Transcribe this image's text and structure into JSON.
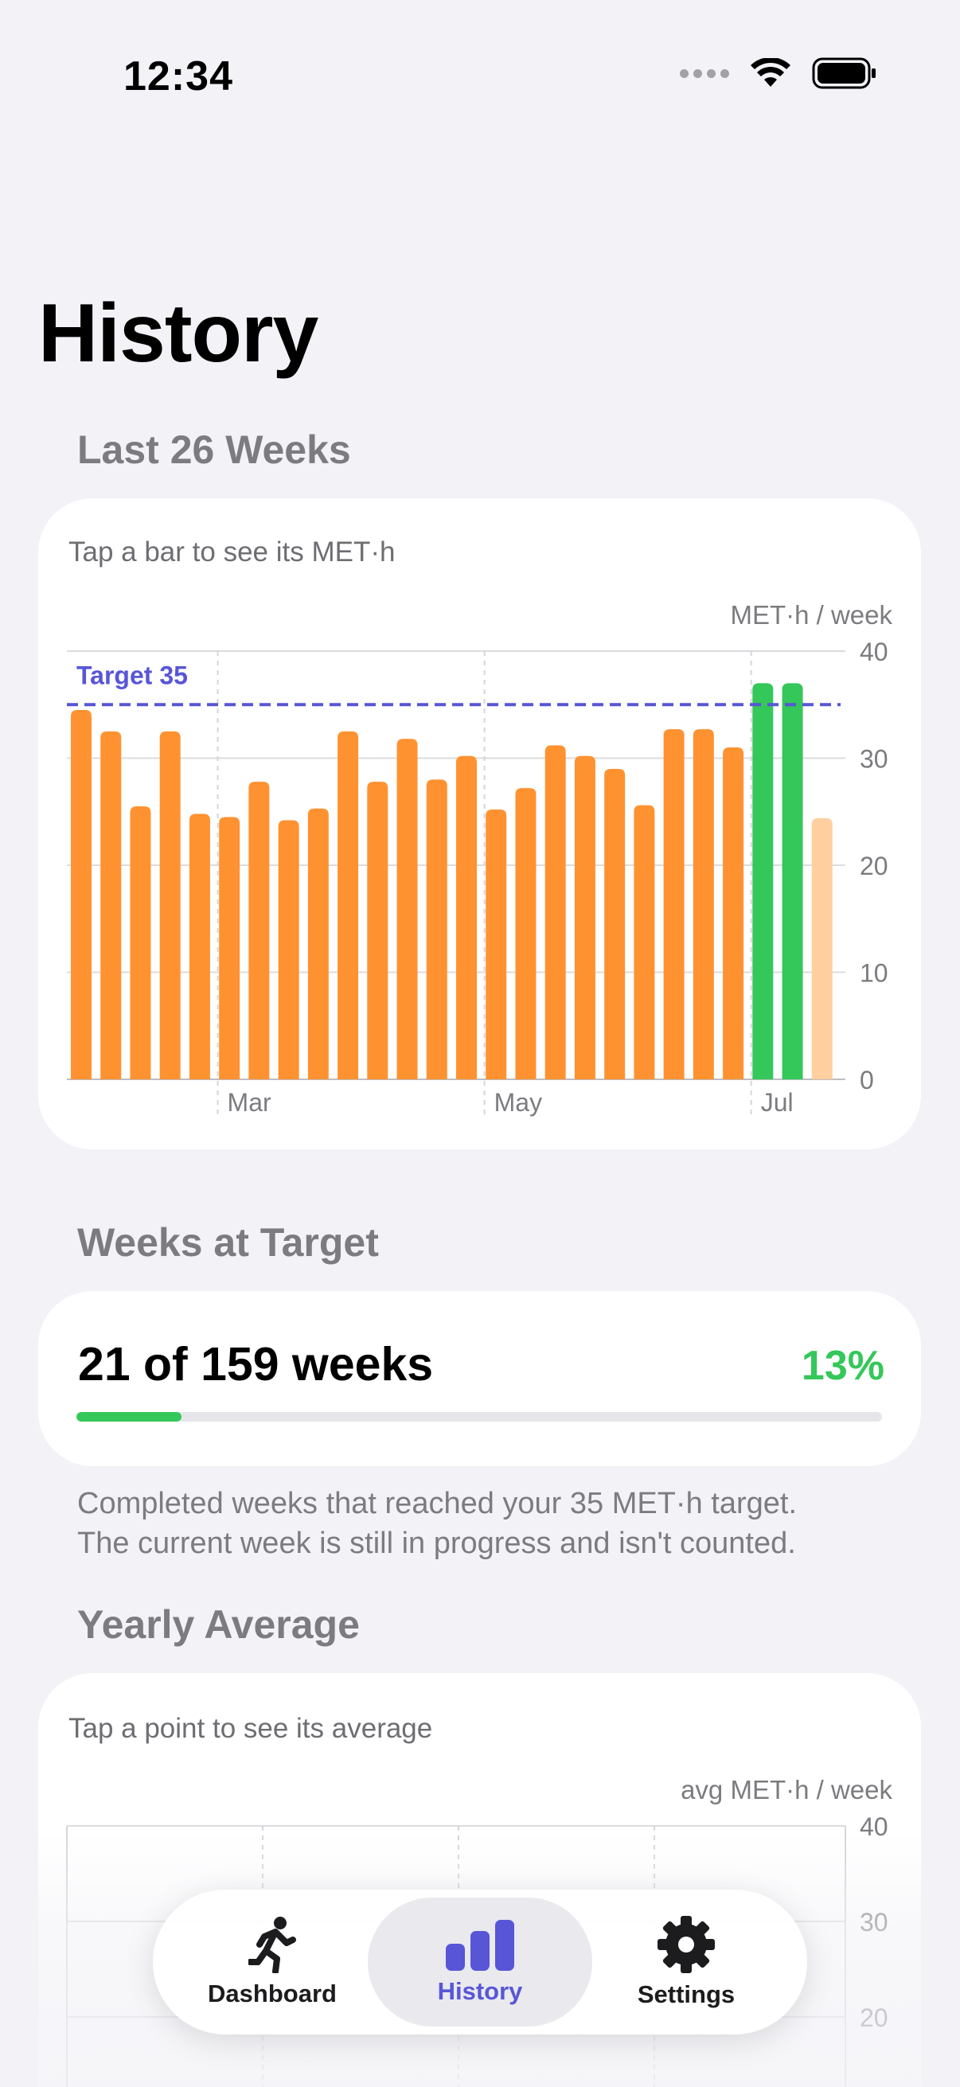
{
  "status": {
    "time": "12:34"
  },
  "page": {
    "title": "History"
  },
  "sections": {
    "weekly": "Last 26 Weeks",
    "target": "Weeks at Target",
    "yearly": "Yearly Average"
  },
  "weekly_chart": {
    "hint": "Tap a bar to see its MET·h",
    "unit": "MET·h / week",
    "target_label": "Target 35"
  },
  "target_card": {
    "text": "21 of 159 weeks",
    "percent": "13%",
    "progress_fraction": 0.13
  },
  "footnote": {
    "line1": "Completed weeks that reached your 35 MET·h target.",
    "line2": "The current week is still in progress and isn't counted."
  },
  "yearly_chart": {
    "hint": "Tap a point to see its average",
    "unit": "avg MET·h / week"
  },
  "tabs": [
    {
      "label": "Dashboard",
      "icon": "running-figure-icon"
    },
    {
      "label": "History",
      "icon": "bar-chart-icon"
    },
    {
      "label": "Settings",
      "icon": "gear-icon"
    }
  ],
  "colors": {
    "at_target": "#34c759",
    "below_target": "#ff9230",
    "in_progress": "#ffcfa0",
    "target_line": "#5856d6",
    "accent": "#5856d6"
  },
  "chart_data": [
    {
      "type": "bar",
      "title": "",
      "xlabel": "",
      "ylabel": "MET·h / week",
      "ylim": [
        0,
        40
      ],
      "yticks": [
        0,
        10,
        20,
        30,
        40
      ],
      "xtick_labels": [
        "Mar",
        "May",
        "Jul"
      ],
      "target": 35,
      "target_label": "Target 35",
      "values": [
        34.5,
        32.5,
        25.5,
        32.5,
        24.8,
        24.5,
        27.8,
        24.2,
        25.3,
        32.5,
        27.8,
        31.8,
        28.0,
        30.2,
        25.2,
        27.2,
        31.2,
        30.2,
        29.0,
        25.6,
        32.7,
        32.7,
        31.0,
        37.0,
        37.0,
        24.4
      ],
      "categories_note": "",
      "grid": true
    },
    {
      "type": "line",
      "title": "",
      "ylabel": "avg MET·h / week",
      "ylim": [
        20,
        40
      ],
      "yticks": [
        20,
        30,
        40
      ],
      "series": [
        {
          "values": []
        }
      ],
      "grid": true
    }
  ]
}
